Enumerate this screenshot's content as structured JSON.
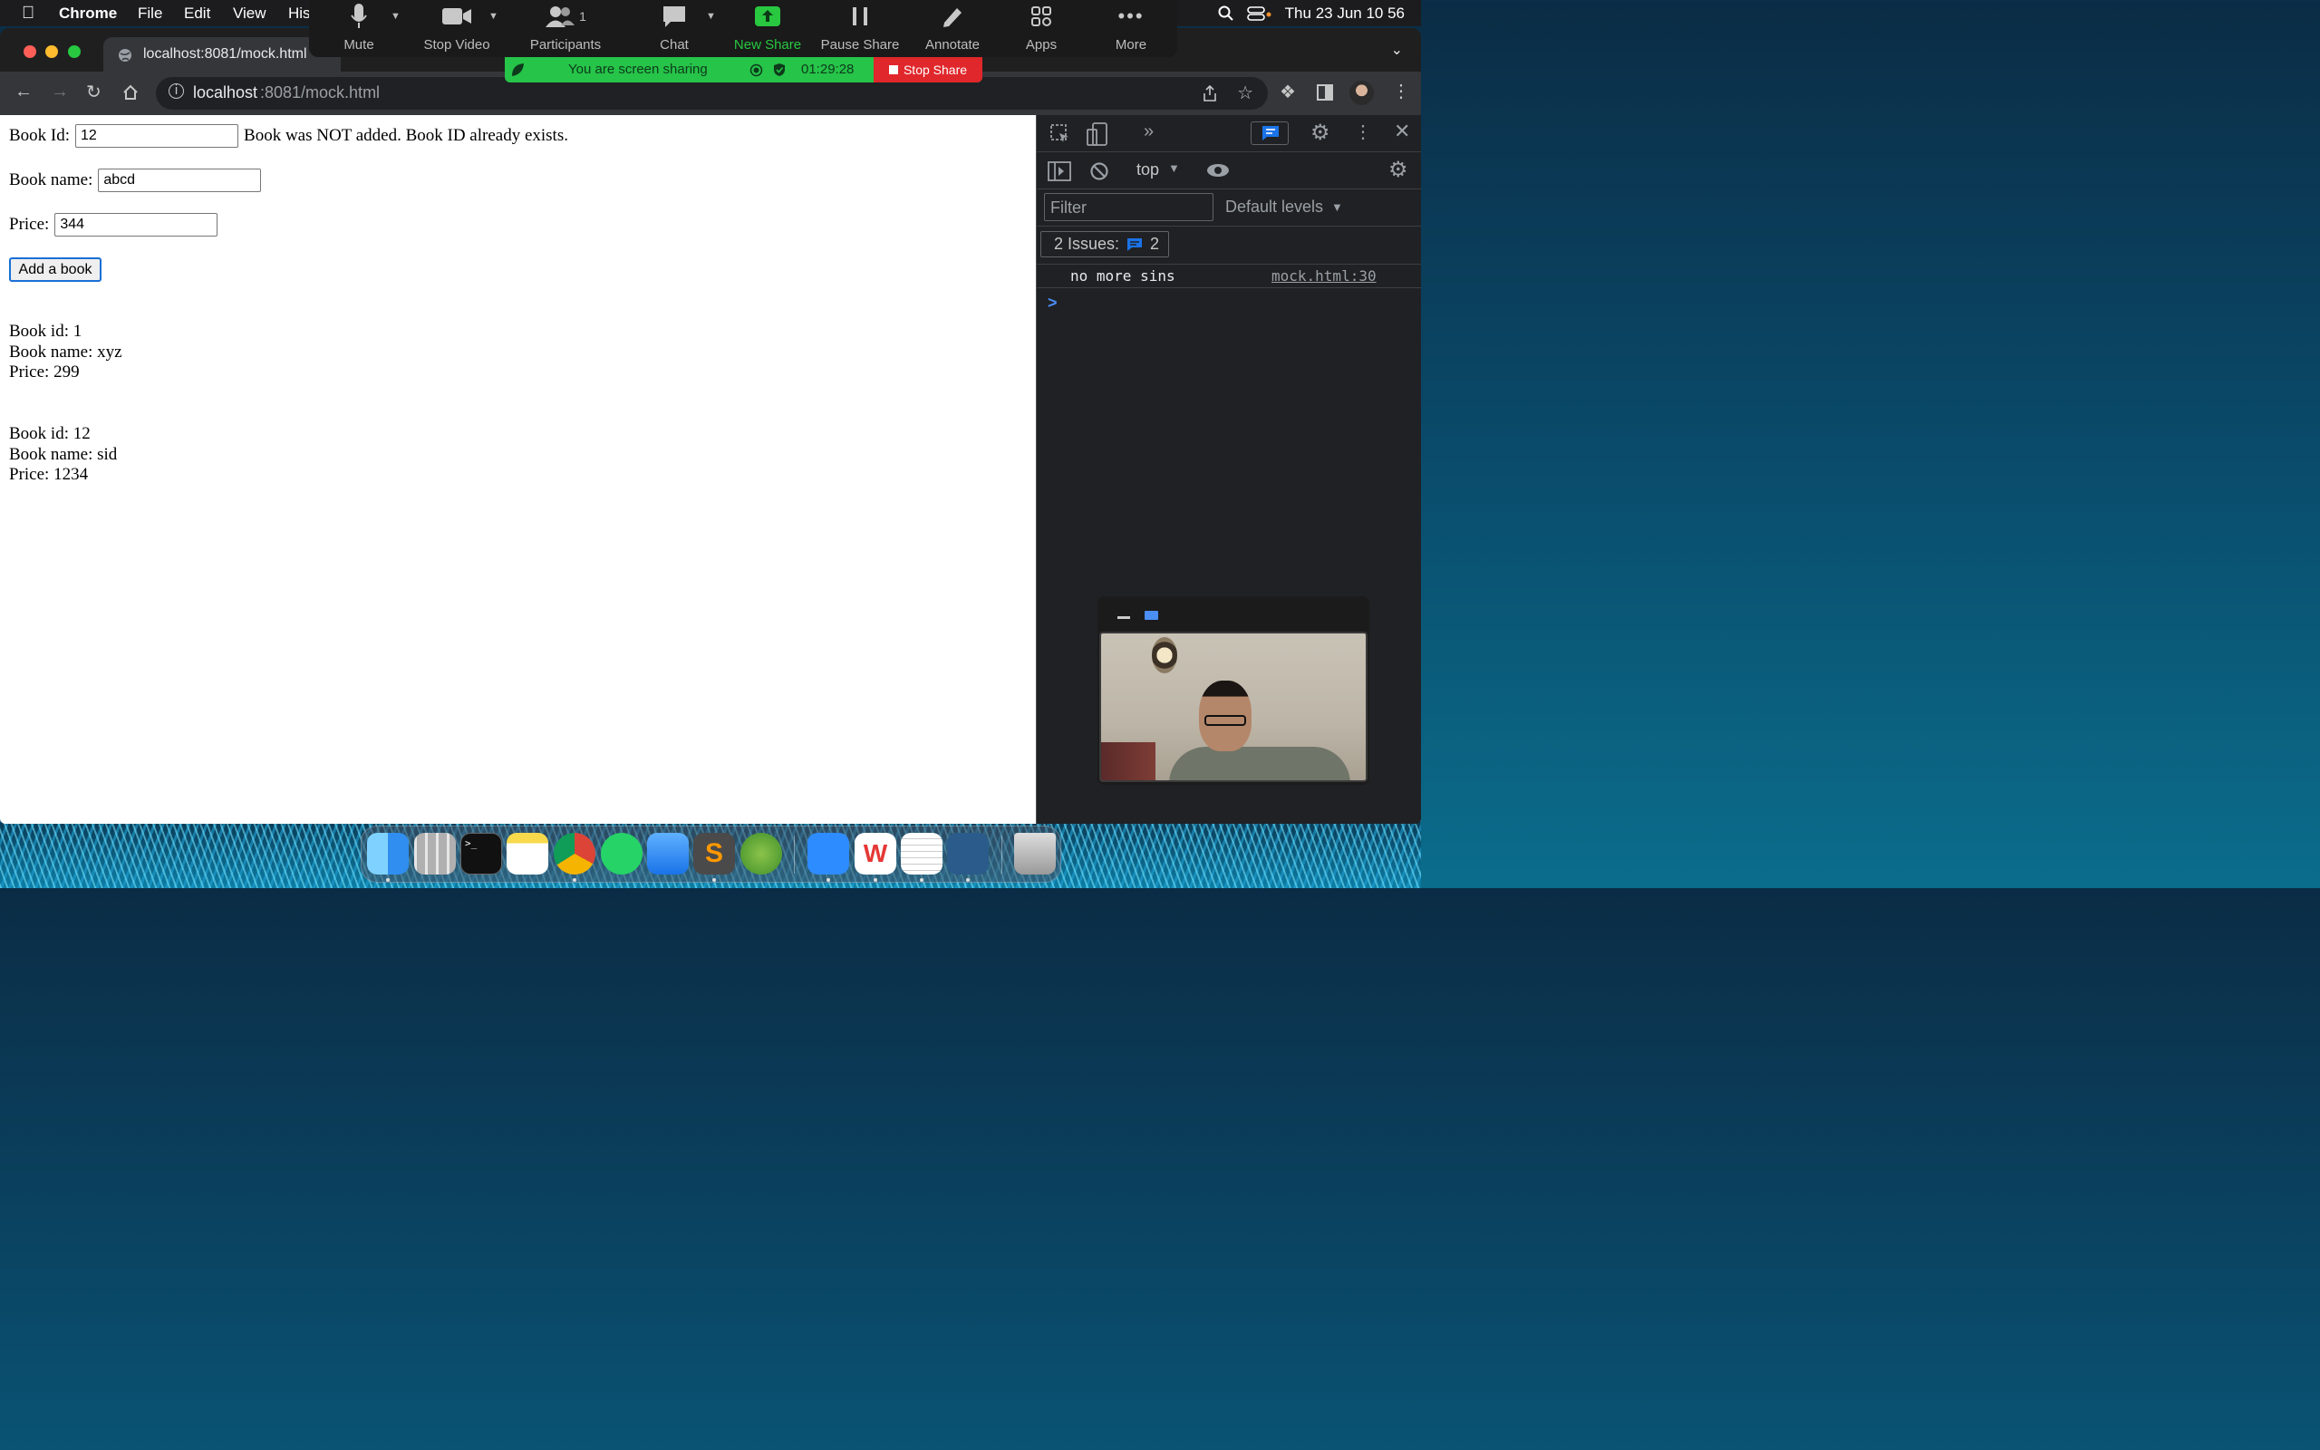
{
  "menubar": {
    "app": "Chrome",
    "items": [
      "File",
      "Edit",
      "View",
      "His"
    ],
    "datetime": "Thu 23 Jun  10 56"
  },
  "zoom": {
    "buttons": [
      {
        "label": "Mute",
        "icon": "microphone-icon"
      },
      {
        "label": "Stop Video",
        "icon": "video-camera-icon"
      },
      {
        "label": "Participants",
        "icon": "participants-icon",
        "badge": "1"
      },
      {
        "label": "Chat",
        "icon": "chat-bubble-icon"
      },
      {
        "label": "New Share",
        "icon": "share-arrow-icon",
        "color": "#28c840"
      },
      {
        "label": "Pause Share",
        "icon": "pause-icon"
      },
      {
        "label": "Annotate",
        "icon": "pencil-icon"
      },
      {
        "label": "Apps",
        "icon": "apps-icon"
      },
      {
        "label": "More",
        "icon": "more-dots-icon"
      }
    ],
    "sharing_text": "You are screen sharing",
    "timer": "01:29:28",
    "stop_share": "Stop Share"
  },
  "browser": {
    "tab_title": "localhost:8081/mock.html",
    "url_host": "localhost",
    "url_rest": ":8081/mock.html"
  },
  "page": {
    "book_id_label": "Book Id:",
    "book_id_value": "12",
    "status_message": "Book was NOT added. Book ID already exists.",
    "book_name_label": "Book name:",
    "book_name_value": "abcd",
    "price_label": "Price:",
    "price_value": "344",
    "add_button": "Add a book",
    "books": [
      {
        "id": "Book id: 1",
        "name": "Book name: xyz",
        "price": "Price: 299"
      },
      {
        "id": "Book id: 12",
        "name": "Book name: sid",
        "price": "Price: 1234"
      }
    ]
  },
  "devtools": {
    "context": "top",
    "filter_placeholder": "Filter",
    "levels": "Default levels",
    "issues_label": "2 Issues:",
    "issues_count": "2",
    "log_message": "no more sins",
    "log_source": "mock.html:30",
    "prompt": ">"
  },
  "colors": {
    "accent": "#1a73e8",
    "share_green": "#26c449",
    "stop_red": "#e0272b"
  }
}
